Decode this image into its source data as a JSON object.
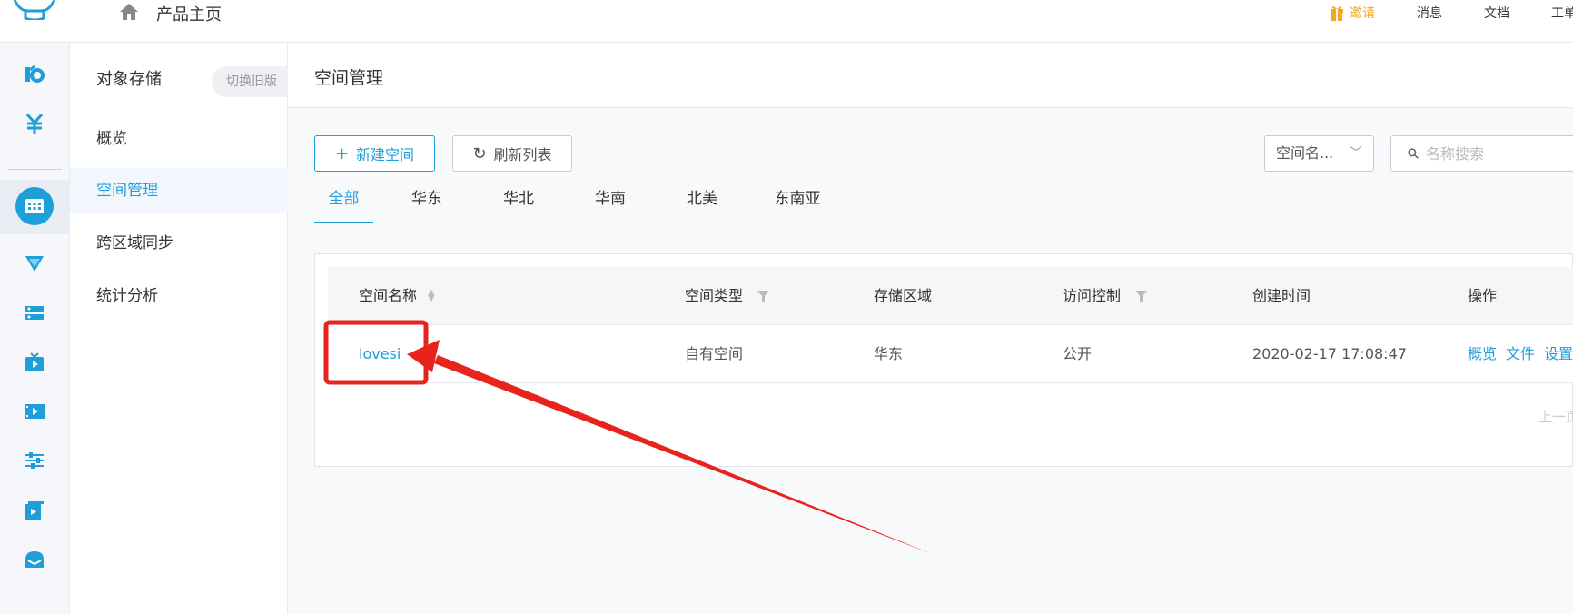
{
  "topbar": {
    "home_label": "产品主页",
    "invite_label": "邀请",
    "messages_label": "消息",
    "docs_label": "文档",
    "tickets_label": "工单",
    "invite_color": "#f5a623"
  },
  "rail": {
    "icons": [
      "kodo-icon",
      "yen-icon",
      "object-storage-icon",
      "cdn-icon",
      "server-icon",
      "live-icon",
      "video-icon",
      "sliders-icon",
      "media-icon",
      "message-icon"
    ]
  },
  "subnav": {
    "title": "对象存储",
    "switch_label": "切换旧版",
    "items": [
      {
        "label": "概览"
      },
      {
        "label": "空间管理"
      },
      {
        "label": "跨区域同步"
      },
      {
        "label": "统计分析"
      }
    ]
  },
  "main": {
    "title": "空间管理",
    "new_button": "新建空间",
    "refresh_button": "刷新列表",
    "select_value": "空间名...",
    "search_placeholder": "名称搜索",
    "tabs": [
      {
        "label": "全部"
      },
      {
        "label": "华东"
      },
      {
        "label": "华北"
      },
      {
        "label": "华南"
      },
      {
        "label": "北美"
      },
      {
        "label": "东南亚"
      }
    ],
    "table": {
      "headers": [
        "空间名称",
        "空间类型",
        "存储区域",
        "访问控制",
        "创建时间",
        "操作"
      ],
      "rows": [
        {
          "name": "lovesi",
          "type": "自有空间",
          "region": "华东",
          "access": "公开",
          "created": "2020-02-17 17:08:47",
          "ops": [
            "概览",
            "文件",
            "设置"
          ]
        }
      ]
    },
    "pager_prev": "上一页"
  },
  "colors": {
    "accent": "#1f9fda",
    "annotation": "#e8231c"
  }
}
